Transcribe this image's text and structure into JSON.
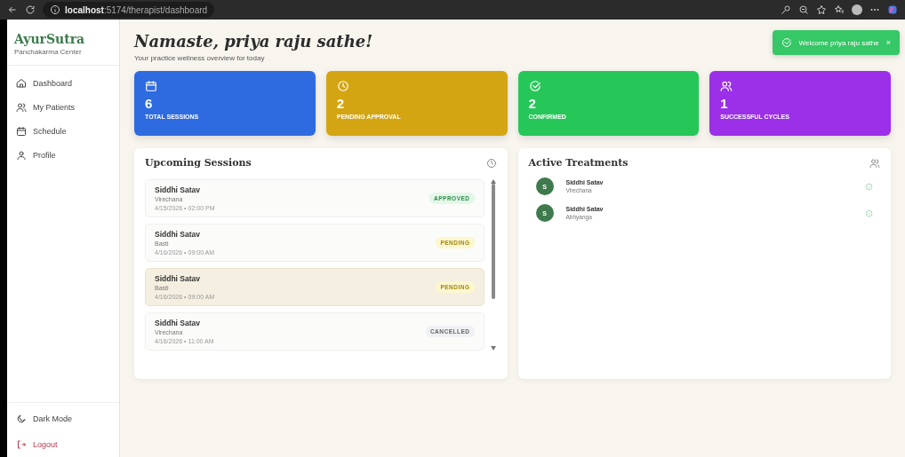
{
  "browser": {
    "url_host": "localhost",
    "url_path": ":5174/therapist/dashboard"
  },
  "sidebar": {
    "brand": "AyurSutra",
    "subtitle": "Panchakarma Center",
    "items": [
      {
        "label": "Dashboard",
        "selected": false
      },
      {
        "label": "My Patients",
        "selected": false
      },
      {
        "label": "Schedule",
        "selected": false
      },
      {
        "label": "Profile",
        "selected": false
      }
    ],
    "footer": [
      {
        "label": "Dark Mode",
        "kind": "theme"
      },
      {
        "label": "Logout",
        "kind": "logout"
      }
    ]
  },
  "header": {
    "title": "Namaste, priya raju sathe!",
    "subtitle": "Your practice wellness overview for today"
  },
  "toast": {
    "message": "Welcome priya raju sathe",
    "close": "×"
  },
  "stats": [
    {
      "value": "6",
      "label": "TOTAL SESSIONS",
      "color": "#2f6be0"
    },
    {
      "value": "2",
      "label": "PENDING APPROVAL",
      "color": "#d4a512"
    },
    {
      "value": "2",
      "label": "CONFIRMED",
      "color": "#27c659"
    },
    {
      "value": "1",
      "label": "SUCCESSFUL CYCLES",
      "color": "#9b30e8"
    }
  ],
  "upcoming": {
    "title": "Upcoming Sessions",
    "separator": "•",
    "sessions": [
      {
        "name": "Siddhi Satav",
        "therapy": "Virechana",
        "date": "4/15/2026",
        "time": "02:00 PM",
        "status": "APPROVED",
        "kind": "approved",
        "selected": false
      },
      {
        "name": "Siddhi Satav",
        "therapy": "Basti",
        "date": "4/16/2026",
        "time": "09:00 AM",
        "status": "PENDING",
        "kind": "pending",
        "selected": false
      },
      {
        "name": "Siddhi Satav",
        "therapy": "Basti",
        "date": "4/16/2026",
        "time": "09:00 AM",
        "status": "PENDING",
        "kind": "pending",
        "selected": true
      },
      {
        "name": "Siddhi Satav",
        "therapy": "Virechana",
        "date": "4/16/2026",
        "time": "11:00 AM",
        "status": "CANCELLED",
        "kind": "cancelled",
        "selected": false
      }
    ]
  },
  "treatments": {
    "title": "Active Treatments",
    "items": [
      {
        "initial": "S",
        "name": "Siddhi Satav",
        "therapy": "Virechana"
      },
      {
        "initial": "S",
        "name": "Siddhi Satav",
        "therapy": "Abhyanga"
      }
    ]
  }
}
